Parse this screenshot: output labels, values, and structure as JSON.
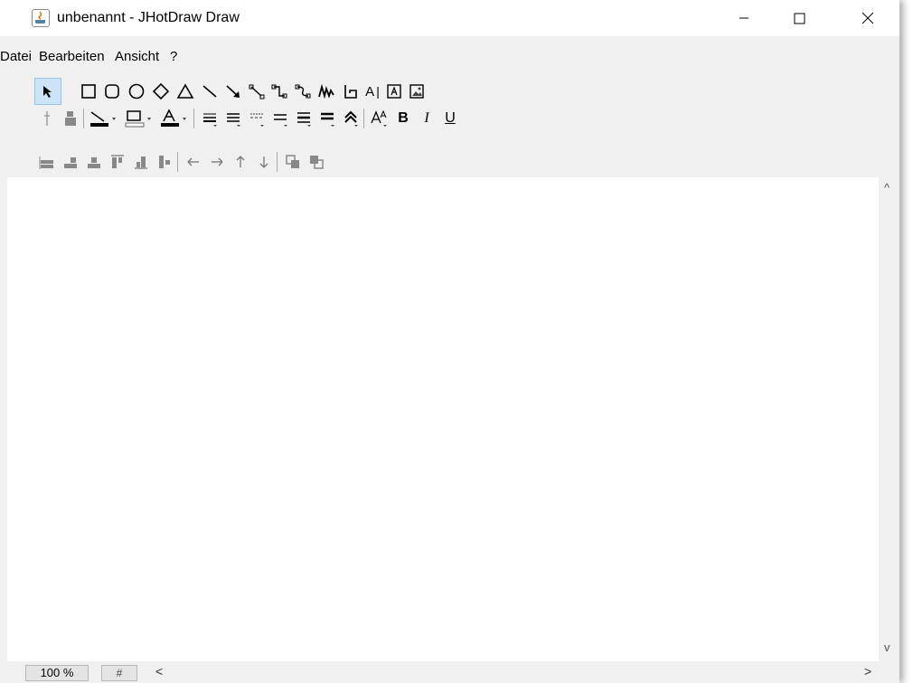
{
  "window": {
    "title": "unbenannt - JHotDraw Draw",
    "minimize_glyph": "—",
    "maximize_glyph": "☐",
    "close_glyph": "✕"
  },
  "menu": {
    "items": [
      "Datei",
      "Bearbeiten",
      "Ansicht",
      "?"
    ]
  },
  "toolbar_create": {
    "tools": [
      "selection-tool",
      "rectangle-tool",
      "round-rectangle-tool",
      "ellipse-tool",
      "diamond-tool",
      "triangle-tool",
      "line-tool",
      "arrow-tool",
      "connector-tool",
      "elbow-connector-tool",
      "curved-connector-tool",
      "scribble-tool",
      "polygon-tool",
      "text-tool",
      "text-area-tool",
      "image-tool"
    ],
    "text_tool_label": "A"
  },
  "toolbar_attributes": {
    "tools": [
      "pick-attributes",
      "apply-attributes",
      "stroke-color",
      "fill-color",
      "text-color",
      "stroke-width",
      "stroke-decoration",
      "stroke-dashes",
      "stroke-type",
      "stroke-placement",
      "stroke-cap",
      "stroke-join",
      "font-face",
      "font-bold",
      "font-italic",
      "font-underline"
    ],
    "bold_label": "B",
    "italic_label": "I",
    "underline_label": "U"
  },
  "toolbar_align": {
    "tools": [
      "align-left",
      "align-center",
      "align-right",
      "align-top",
      "align-middle",
      "align-bottom",
      "move-left",
      "move-right",
      "move-up",
      "move-down",
      "bring-to-front",
      "send-to-back"
    ]
  },
  "statusbar": {
    "zoom": "100 %",
    "grid_toggle": "#",
    "scroll_left": "<",
    "scroll_right": ">"
  },
  "scrollbar": {
    "up": "^",
    "down": "v"
  }
}
